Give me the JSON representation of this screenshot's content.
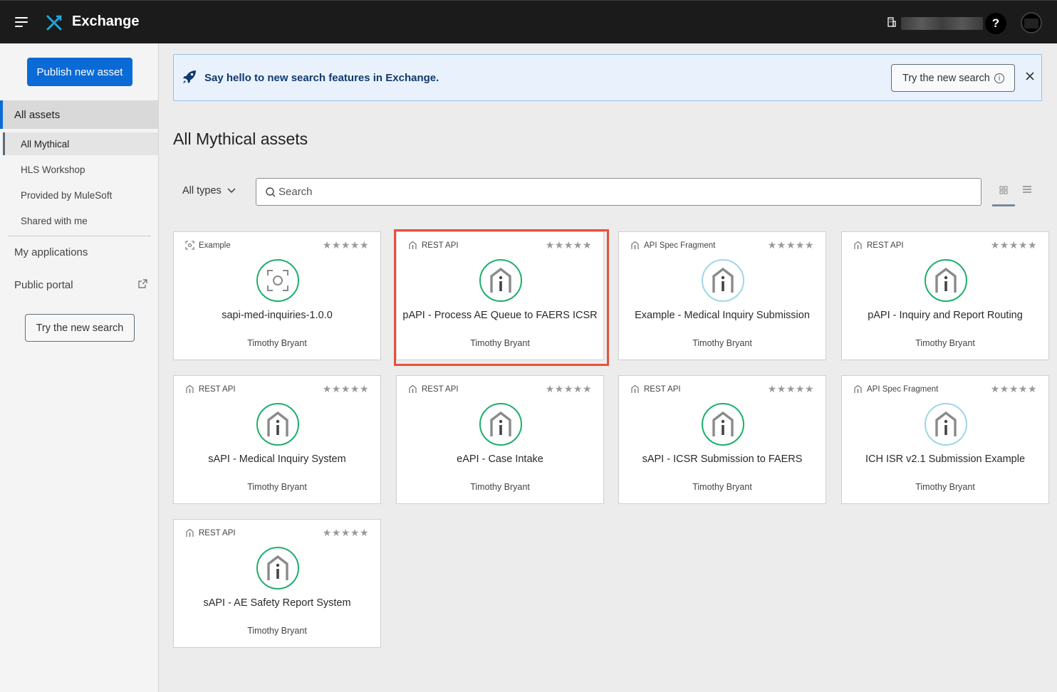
{
  "header": {
    "app_title": "Exchange",
    "help_label": "?"
  },
  "sidebar": {
    "publish_label": "Publish new asset",
    "all_assets_label": "All assets",
    "sub_items": [
      {
        "label": "All Mythical",
        "active": true
      },
      {
        "label": "HLS Workshop",
        "active": false
      },
      {
        "label": "Provided by MuleSoft",
        "active": false
      },
      {
        "label": "Shared with me",
        "active": false
      }
    ],
    "my_applications_label": "My applications",
    "public_portal_label": "Public portal",
    "try_search_label": "Try the new search"
  },
  "banner": {
    "message": "Say hello to new search features in Exchange.",
    "try_label": "Try the new search",
    "info_glyph": "i"
  },
  "main": {
    "title": "All Mythical assets",
    "type_filter_label": "All types",
    "search_placeholder": "Search"
  },
  "cards": [
    {
      "type": "Example",
      "name": "sapi-med-inquiries-1.0.0",
      "author": "Timothy Bryant",
      "rating": "★★★★★",
      "icon": "example-icon"
    },
    {
      "type": "REST API",
      "name": "pAPI - Process AE Queue to FAERS ICSR",
      "author": "Timothy Bryant",
      "rating": "★★★★★",
      "icon": "rest-api-icon"
    },
    {
      "type": "API Spec Fragment",
      "name": "Example - Medical Inquiry Submission",
      "author": "Timothy Bryant",
      "rating": "★★★★★",
      "icon": "fragment-icon"
    },
    {
      "type": "REST API",
      "name": "pAPI - Inquiry and Report Routing",
      "author": "Timothy Bryant",
      "rating": "★★★★★",
      "icon": "rest-api-icon"
    },
    {
      "type": "REST API",
      "name": "sAPI - Medical Inquiry System",
      "author": "Timothy Bryant",
      "rating": "★★★★★",
      "icon": "rest-api-icon"
    },
    {
      "type": "REST API",
      "name": "eAPI - Case Intake",
      "author": "Timothy Bryant",
      "rating": "★★★★★",
      "icon": "rest-api-icon"
    },
    {
      "type": "REST API",
      "name": "sAPI - ICSR Submission to FAERS",
      "author": "Timothy Bryant",
      "rating": "★★★★★",
      "icon": "rest-api-icon"
    },
    {
      "type": "API Spec Fragment",
      "name": "ICH ISR v2.1 Submission Example",
      "author": "Timothy Bryant",
      "rating": "★★★★★",
      "icon": "fragment-icon"
    },
    {
      "type": "REST API",
      "name": "sAPI - AE Safety Report System",
      "author": "Timothy Bryant",
      "rating": "★★★★★",
      "icon": "rest-api-icon"
    }
  ],
  "colors": {
    "accent": "#0b6bd6",
    "rest_ring": "#1fae6b",
    "fragment_ring": "#9fd6e8",
    "highlight": "#e8503c"
  }
}
